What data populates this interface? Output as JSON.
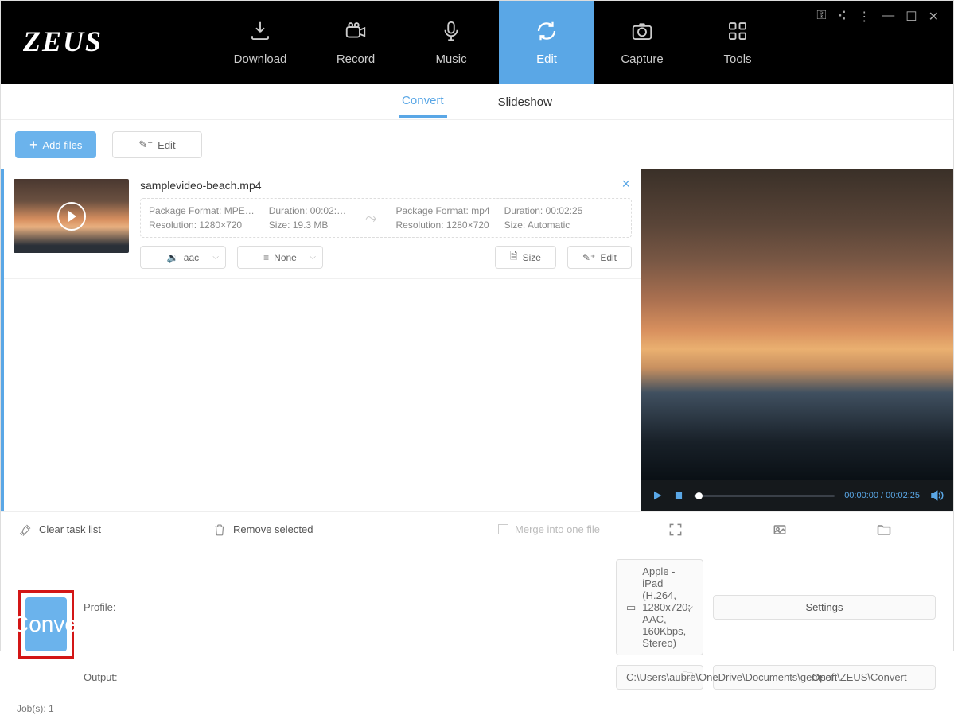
{
  "app": {
    "logo": "ZEUS"
  },
  "nav": {
    "download": "Download",
    "record": "Record",
    "music": "Music",
    "edit": "Edit",
    "capture": "Capture",
    "tools": "Tools"
  },
  "subtabs": {
    "convert": "Convert",
    "slideshow": "Slideshow"
  },
  "actions": {
    "add_files": "Add files",
    "edit": "Edit"
  },
  "file": {
    "name": "samplevideo-beach.mp4",
    "src_pkg": "Package Format: MPE…",
    "src_res": "Resolution: 1280×720",
    "src_dur": "Duration:  00:02:…",
    "src_size": "Size: 19.3 MB",
    "dst_pkg": "Package Format: mp4",
    "dst_res": "Resolution: 1280×720",
    "dst_dur": "Duration: 00:02:25",
    "dst_size": "Size: Automatic",
    "audio_sel": "aac",
    "sub_sel": "None",
    "size_btn": "Size",
    "edit_btn": "Edit"
  },
  "preview": {
    "time": "00:00:00 / 00:02:25"
  },
  "lower": {
    "clear": "Clear task list",
    "remove": "Remove selected",
    "merge": "Merge into one file"
  },
  "bottom": {
    "profile_label": "Profile:",
    "profile_value": "Apple - iPad (H.264, 1280x720; AAC, 160Kbps, Stereo)",
    "output_label": "Output:",
    "output_value": "C:\\Users\\aubre\\OneDrive\\Documents\\gemsoft\\ZEUS\\Convert",
    "settings": "Settings",
    "open": "Open",
    "convert": "Convert"
  },
  "status": {
    "jobs": "Job(s): 1"
  }
}
